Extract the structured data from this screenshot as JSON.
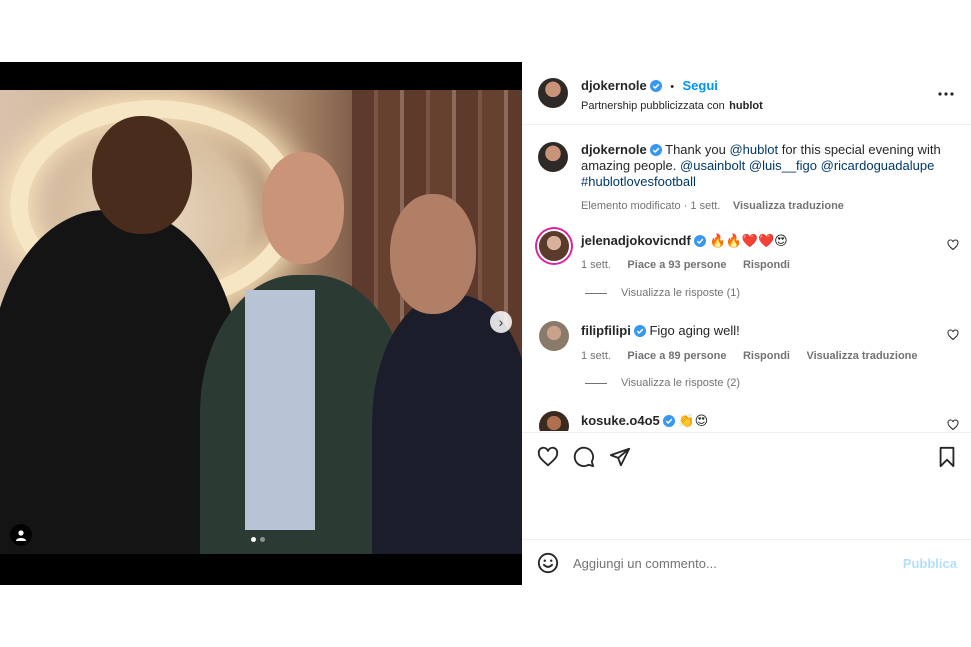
{
  "post": {
    "author": {
      "username": "djokernole",
      "follow_label": "Segui",
      "separator": "•",
      "partnership_prefix": "Partnership pubblicizzata con",
      "partner": "hublot"
    },
    "more_icon": "more-horizontal-icon",
    "caption": {
      "username": "djokernole",
      "part1": "Thank you ",
      "mention_hublot": "@hublot",
      "part2": " for this special evening with amazing people. ",
      "mention_usainbolt": "@usainbolt",
      "mention_figo": "@luis__figo",
      "mention_ricardo": "@ricardoguadalupe",
      "hashtag": "#hublotlovesfootball",
      "meta_edited": "Elemento modificato · 1 sett.",
      "meta_translate": "Visualizza traduzione"
    }
  },
  "comments": [
    {
      "username": "jelenadjokovicndf",
      "text": "🔥🔥❤️❤️😍",
      "time": "1 sett.",
      "likes": "Piace a 93 persone",
      "reply": "Rispondi",
      "view_replies": "Visualizza le risposte (1)"
    },
    {
      "username": "filipfilipi",
      "text": "Figo aging well!",
      "time": "1 sett.",
      "likes": "Piace a 89 persone",
      "reply": "Rispondi",
      "translate": "Visualizza traduzione",
      "view_replies": "Visualizza le risposte (2)"
    },
    {
      "username": "kosuke.o4o5",
      "text": "👏😍"
    }
  ],
  "composer": {
    "placeholder": "Aggiungi un commento...",
    "publish": "Pubblica"
  },
  "carousel": {
    "current": 1,
    "total": 2
  },
  "colors": {
    "accent": "#0095f6",
    "verified": "#3897f0",
    "link": "#00376b",
    "muted": "#737373",
    "publish_disabled": "#b2dffc"
  }
}
